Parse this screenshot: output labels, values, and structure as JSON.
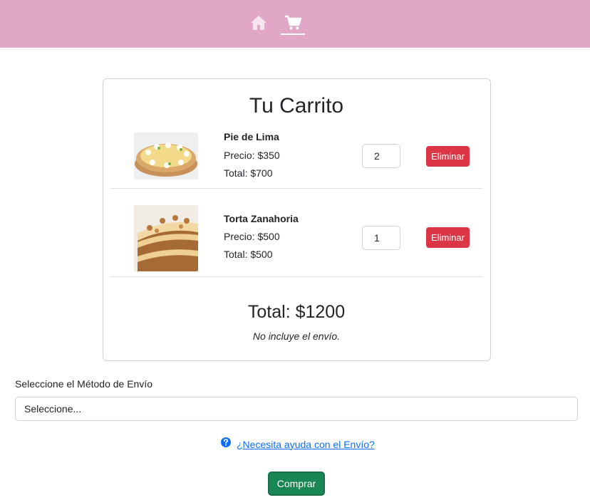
{
  "nav": {
    "home_icon": "home-icon",
    "cart_icon": "cart-icon",
    "active": "cart"
  },
  "cart": {
    "title": "Tu Carrito",
    "items": [
      {
        "name": "Pie de Lima",
        "price": "Precio: $350",
        "total": "Total: $700",
        "quantity": "2",
        "remove_label": "Eliminar"
      },
      {
        "name": "Torta Zanahoria",
        "price": "Precio: $500",
        "total": "Total: $500",
        "quantity": "1",
        "remove_label": "Eliminar"
      }
    ],
    "grand_total": "Total: $1200",
    "shipping_note": "No incluye el envío."
  },
  "shipping": {
    "label": "Seleccione el Método de Envío",
    "selected": "Seleccione...",
    "help_link": "¿Necesita ayuda con el Envío?"
  },
  "buy_label": "Comprar",
  "colors": {
    "navbar": "#e0a8c6",
    "danger": "#dc3545",
    "success": "#198754",
    "link": "#0d6efd"
  }
}
